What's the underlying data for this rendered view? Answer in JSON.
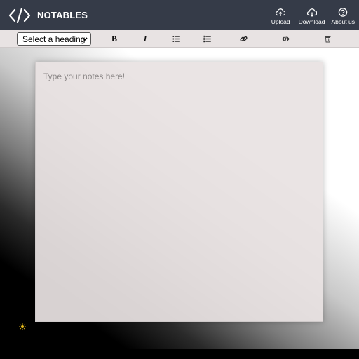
{
  "header": {
    "brand": "NOTABLES",
    "logo_icon": "code-brackets-icon",
    "nav": [
      {
        "label": "Upload",
        "icon": "cloud-upload-icon"
      },
      {
        "label": "Download",
        "icon": "cloud-download-icon"
      },
      {
        "label": "About us",
        "icon": "question-circle-icon"
      }
    ],
    "background": "#353b48"
  },
  "toolbar": {
    "heading_select": {
      "selected": "Select a heading"
    },
    "bold_label": "B",
    "italic_label": "I",
    "buttons": [
      "bold",
      "italic",
      "bullet-list",
      "numbered-list",
      "link",
      "code",
      "delete"
    ],
    "background": "#e8e3e3"
  },
  "editor": {
    "placeholder": "Type your notes here!",
    "value": ""
  },
  "theme_toggle": {
    "icon": "sun-icon",
    "color": "#e5b91a"
  }
}
